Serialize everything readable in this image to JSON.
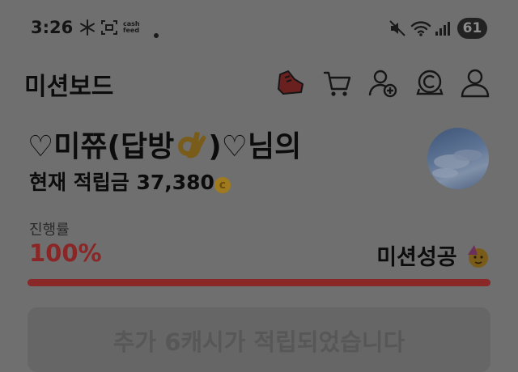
{
  "status_bar": {
    "time": "3:26",
    "cash_text": "cash feed",
    "battery": "61",
    "icons": [
      "snowflake-icon",
      "screenshot-icon",
      "cashfeed-icon",
      "dot-icon",
      "mute-icon",
      "wifi-icon",
      "signal-icon"
    ]
  },
  "header": {
    "title": "미션보드",
    "icons": [
      "sneaker-icon",
      "cart-icon",
      "add-friend-icon",
      "coin-c-icon",
      "profile-icon"
    ]
  },
  "user": {
    "name_prefix": "♡미쮸(답방",
    "name_suffix": ")♡님의",
    "balance_label": "현재 적립금",
    "balance_value": "37,380",
    "coin_symbol": "c"
  },
  "progress": {
    "label": "진행률",
    "value": "100%",
    "fraction": 1.0,
    "status": "미션성공"
  },
  "notice": {
    "text": "추가 6캐시가 적립되었습니다"
  },
  "colors": {
    "overlay_background": "#6f6f6f",
    "progress_accent": "#8a2727"
  }
}
